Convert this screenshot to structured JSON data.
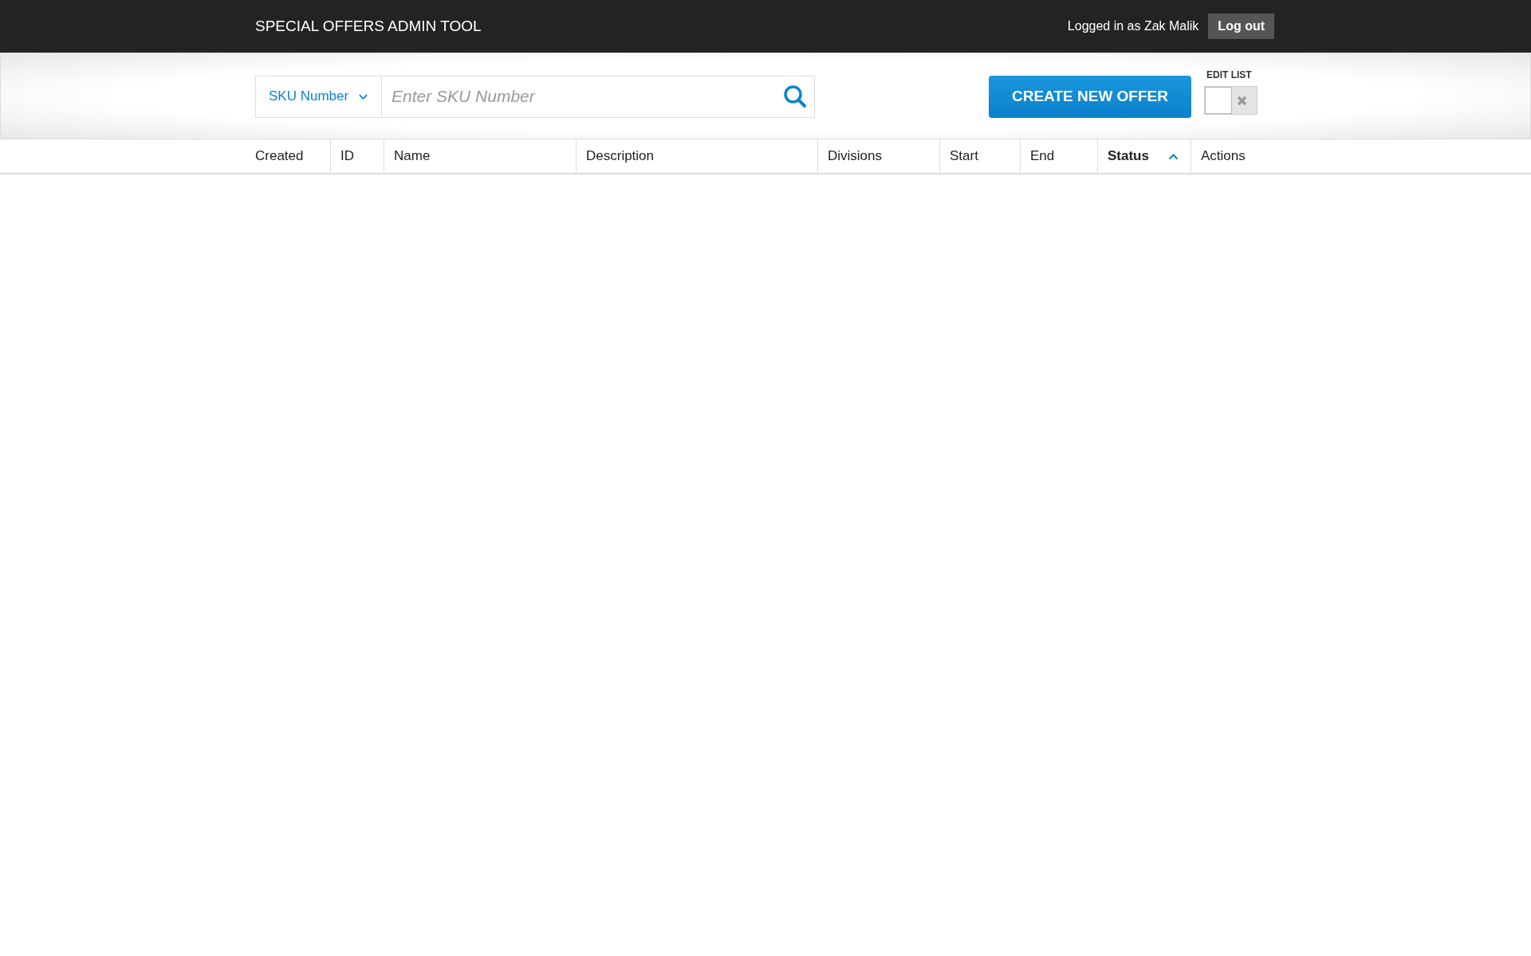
{
  "header": {
    "title": "SPECIAL OFFERS ADMIN TOOL",
    "user_text": "Logged in as Zak Malik",
    "logout": "Log out"
  },
  "search": {
    "filter": "SKU Number",
    "placeholder": "Enter SKU Number"
  },
  "create_button": "CREATE NEW OFFER",
  "edit_list": {
    "label": "EDIT LIST",
    "on": false
  },
  "table": {
    "columns": [
      {
        "label": "Created",
        "sorted": false
      },
      {
        "label": "ID",
        "sorted": false
      },
      {
        "label": "Name",
        "sorted": false
      },
      {
        "label": "Description",
        "sorted": false
      },
      {
        "label": "Divisions",
        "sorted": false
      },
      {
        "label": "Start",
        "sorted": false
      },
      {
        "label": "End",
        "sorted": false
      },
      {
        "label": "Status",
        "sorted": true
      },
      {
        "label": "Actions",
        "sorted": false
      }
    ]
  }
}
